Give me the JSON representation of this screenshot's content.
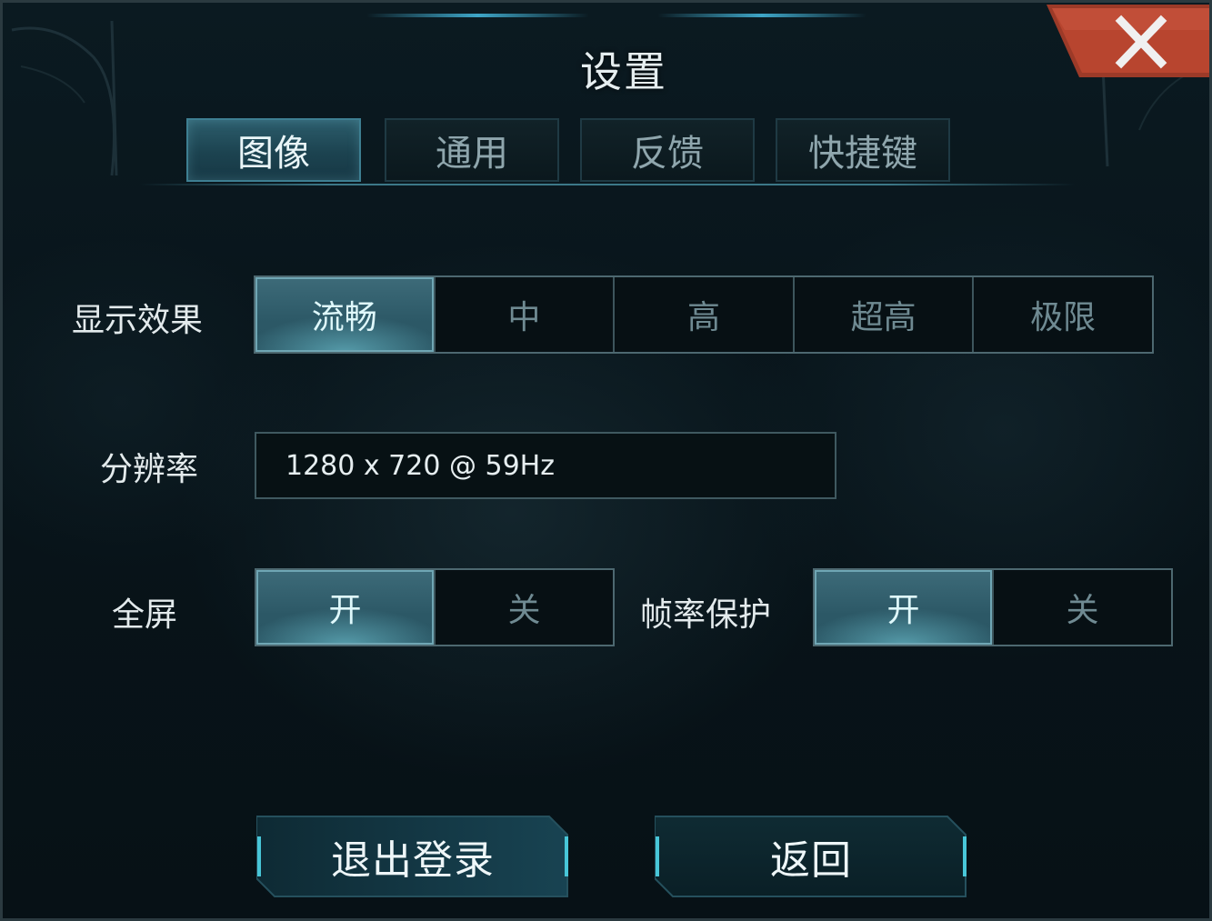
{
  "dialog": {
    "title": "设置",
    "close_icon": "close-x-icon"
  },
  "tabs": [
    {
      "label": "图像",
      "active": true
    },
    {
      "label": "通用",
      "active": false
    },
    {
      "label": "反馈",
      "active": false
    },
    {
      "label": "快捷键",
      "active": false
    }
  ],
  "graphics_quality": {
    "label": "显示效果",
    "options": [
      "流畅",
      "中",
      "高",
      "超高",
      "极限"
    ],
    "selected": "流畅"
  },
  "resolution": {
    "label": "分辨率",
    "value": "1280 x 720 @ 59Hz"
  },
  "fullscreen": {
    "label": "全屏",
    "on_label": "开",
    "off_label": "关",
    "selected": "开"
  },
  "frame_rate_protection": {
    "label": "帧率保护",
    "on_label": "开",
    "off_label": "关",
    "selected": "开"
  },
  "buttons": {
    "logout": "退出登录",
    "back": "返回"
  },
  "colors": {
    "accent": "#3ea6c8",
    "close_red": "#b8442f",
    "selected_fill": "#2c5866"
  }
}
